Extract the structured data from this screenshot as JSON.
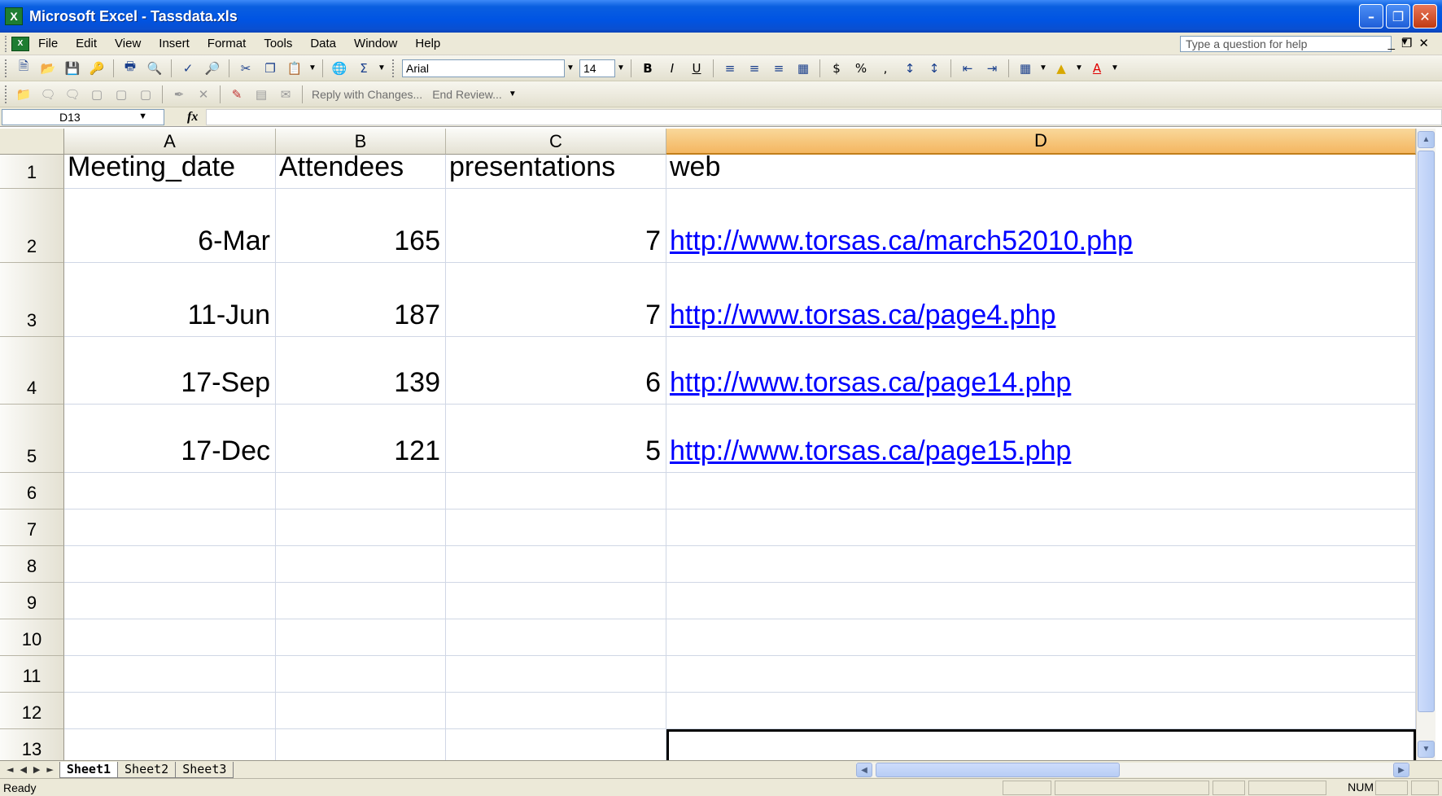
{
  "window": {
    "title": "Microsoft Excel - Tassdata.xls",
    "icon": "excel-app-icon",
    "controls": [
      "minimize",
      "restore",
      "close"
    ]
  },
  "menu": {
    "items": [
      "File",
      "Edit",
      "View",
      "Insert",
      "Format",
      "Tools",
      "Data",
      "Window",
      "Help"
    ],
    "help_placeholder": "Type a question for help"
  },
  "toolbar": {
    "font_name": "Arial",
    "font_size": "14",
    "reply_with_changes": "Reply with Changes...",
    "end_review": "End Review..."
  },
  "formula_bar": {
    "name_box": "D13",
    "fx_label": "fx",
    "formula": ""
  },
  "sheet": {
    "columns": [
      "A",
      "B",
      "C",
      "D"
    ],
    "rows": [
      "1",
      "2",
      "3",
      "4",
      "5",
      "6",
      "7",
      "8",
      "9",
      "10",
      "11",
      "12",
      "13"
    ],
    "header_row": [
      "Meeting_date",
      "Attendees",
      "presentations",
      "web"
    ],
    "data_rows": [
      [
        "6-Mar",
        "165",
        "7",
        "http://www.torsas.ca/march52010.php"
      ],
      [
        "11-Jun",
        "187",
        "7",
        "http://www.torsas.ca/page4.php"
      ],
      [
        "17-Sep",
        "139",
        "6",
        "http://www.torsas.ca/page14.php"
      ],
      [
        "17-Dec",
        "121",
        "5",
        "http://www.torsas.ca/page15.php"
      ]
    ],
    "active_cell": "D13",
    "tabs": [
      "Sheet1",
      "Sheet2",
      "Sheet3"
    ],
    "active_tab": "Sheet1"
  },
  "status": {
    "text": "Ready",
    "num_indicator": "NUM"
  },
  "colors": {
    "titlebar": "#0054e3",
    "link": "#0000ff",
    "active_header": "#f4b660"
  }
}
